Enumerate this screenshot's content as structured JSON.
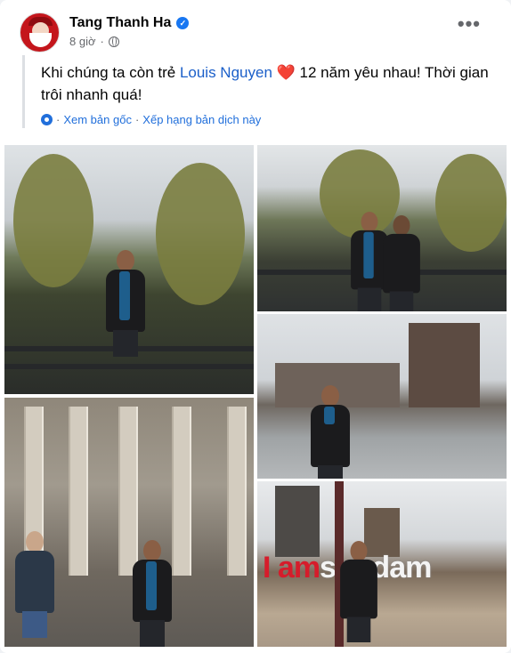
{
  "post": {
    "author": "Tang Thanh Ha",
    "time": "8 giờ",
    "more_label": "•••",
    "verified_icon": "verified-badge-icon",
    "privacy_icon": "globe-icon",
    "text_before": "Khi chúng ta còn trẻ ",
    "mention": "Louis Nguyen",
    "emoji": "❤️",
    "text_after": " 12 năm yêu nhau! Thời gian trôi nhanh quá!",
    "translation": {
      "view_original": "Xem bản gốc",
      "separator": "·",
      "rate": "Xếp hạng bản dịch này"
    },
    "photo_sign": {
      "part1": "I",
      "part2": "am",
      "part3": "sterdam"
    }
  },
  "colors": {
    "link": "#216fdb",
    "mention": "#1b5fc9",
    "verified": "#1877f2",
    "secondary_text": "#65676b"
  }
}
